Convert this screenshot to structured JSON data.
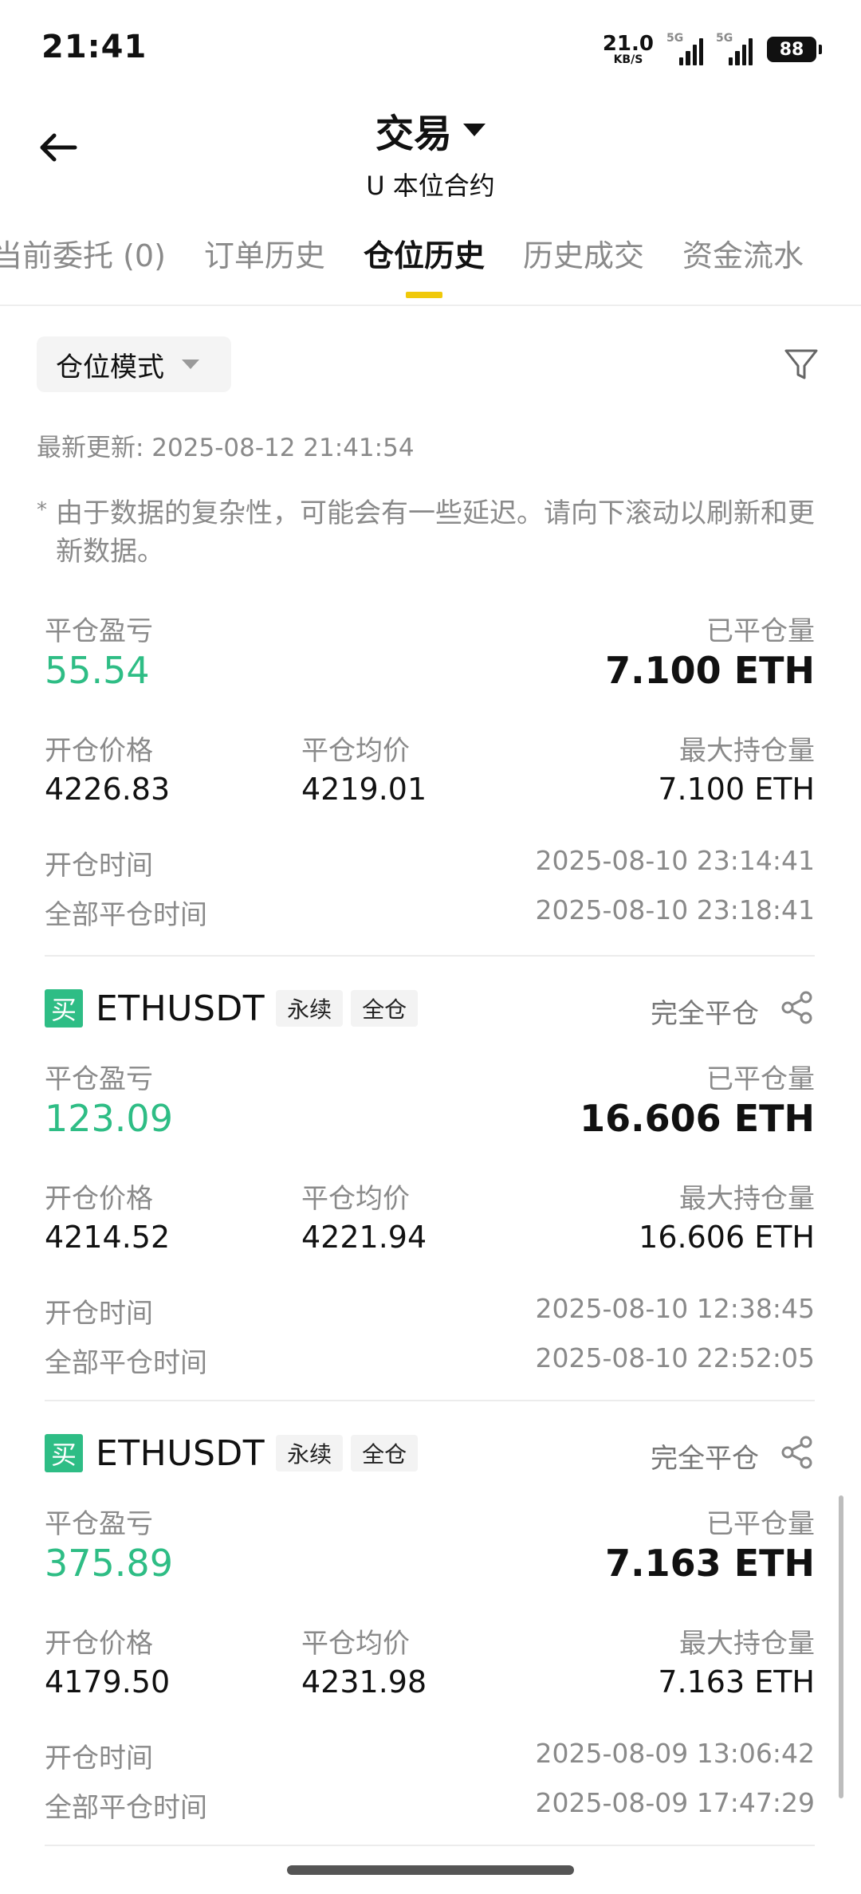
{
  "status_bar": {
    "time": "21:41",
    "net_speed_value": "21.0",
    "net_speed_unit": "KB/S",
    "signal1_label": "5G",
    "signal2_label": "5G",
    "battery": "88"
  },
  "header": {
    "title": "交易",
    "subtitle": "U 本位合约"
  },
  "tabs": [
    {
      "label": "当前委托 (0)"
    },
    {
      "label": "订单历史"
    },
    {
      "label": "仓位历史"
    },
    {
      "label": "历史成交"
    },
    {
      "label": "资金流水"
    }
  ],
  "filter": {
    "mode_label": "仓位模式"
  },
  "update_time": "最新更新: 2025-08-12 21:41:54",
  "note": {
    "star": "*",
    "text": "由于数据的复杂性，可能会有一些延迟。请向下滚动以刷新和更新数据。"
  },
  "labels": {
    "pnl": "平仓盈亏",
    "closed_qty": "已平仓量",
    "open_price": "开仓价格",
    "close_avg": "平仓均价",
    "max_pos": "最大持仓量",
    "open_time": "开仓时间",
    "close_time": "全部平仓时间"
  },
  "cards": [
    {
      "pnl": "55.54",
      "closed_qty": "7.100 ETH",
      "open_price": "4226.83",
      "close_avg": "4219.01",
      "max_pos": "7.100 ETH",
      "open_time": "2025-08-10 23:14:41",
      "close_time": "2025-08-10 23:18:41"
    },
    {
      "side": "买",
      "symbol": "ETHUSDT",
      "tag1": "永续",
      "tag2": "全仓",
      "status": "完全平仓",
      "pnl": "123.09",
      "closed_qty": "16.606 ETH",
      "open_price": "4214.52",
      "close_avg": "4221.94",
      "max_pos": "16.606 ETH",
      "open_time": "2025-08-10 12:38:45",
      "close_time": "2025-08-10 22:52:05"
    },
    {
      "side": "买",
      "symbol": "ETHUSDT",
      "tag1": "永续",
      "tag2": "全仓",
      "status": "完全平仓",
      "pnl": "375.89",
      "closed_qty": "7.163 ETH",
      "open_price": "4179.50",
      "close_avg": "4231.98",
      "max_pos": "7.163 ETH",
      "open_time": "2025-08-09 13:06:42",
      "close_time": "2025-08-09 17:47:29"
    }
  ],
  "colors": {
    "profit_green": "#2ebd85",
    "tab_indicator": "#f0c90a",
    "muted_text": "#8a8a8a"
  }
}
